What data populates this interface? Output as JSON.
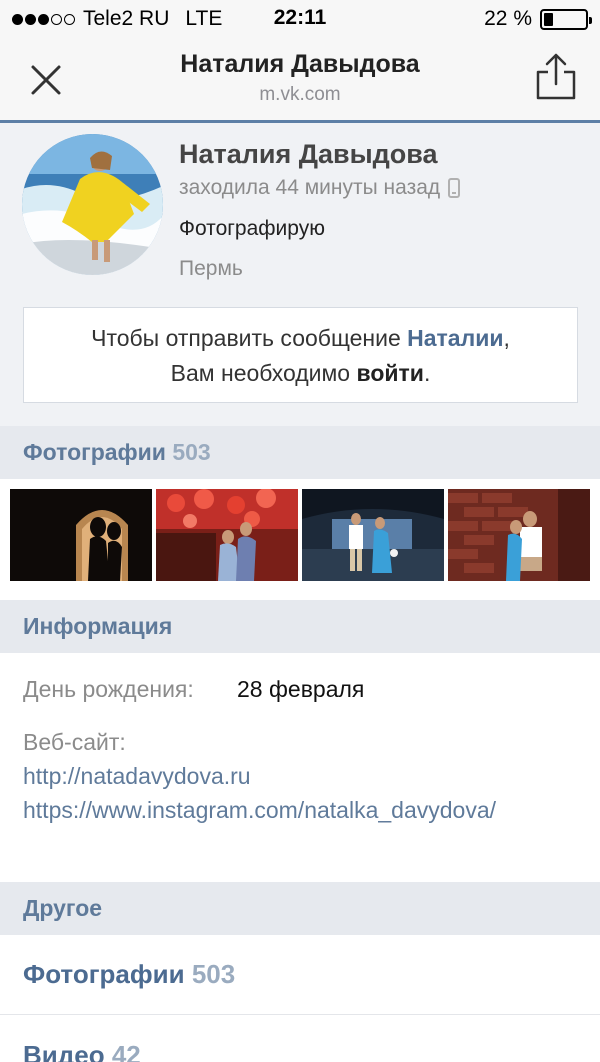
{
  "status_bar": {
    "carrier": "Tele2 RU",
    "network": "LTE",
    "time": "22:11",
    "battery": "22 %",
    "battery_level": 0.22,
    "signal_filled": 3,
    "signal_total": 5
  },
  "browser": {
    "title": "Наталия Давыдова",
    "url": "m.vk.com",
    "close_icon": "close-icon",
    "share_icon": "share-icon"
  },
  "profile": {
    "name": "Наталия Давыдова",
    "last_seen": "заходила 44 минуты назад",
    "status": "Фотографирую",
    "city": "Пермь",
    "message": {
      "part1": "Чтобы отправить сообщение ",
      "name_link": "Наталии",
      "part2": ",",
      "part3": "Вам необходимо ",
      "login_link": "войти",
      "part4": "."
    }
  },
  "photos": {
    "title": "Фотографии",
    "count": "503"
  },
  "info": {
    "title": "Информация",
    "birthday_label": "День рождения:",
    "birthday_value": "28 февраля",
    "website_label": "Веб-сайт:",
    "links": [
      "http://natadavydova.ru",
      "https://www.instagram.com/natalka_davydova/"
    ]
  },
  "other": {
    "title": "Другое",
    "items": [
      {
        "label": "Фотографии",
        "count": "503"
      },
      {
        "label": "Видео",
        "count": "42"
      }
    ]
  },
  "colors": {
    "accent": "#5d7fa6",
    "link": "#4c6b91",
    "section_bg": "#e6e9ee",
    "profile_bg": "#f0f2f5"
  }
}
